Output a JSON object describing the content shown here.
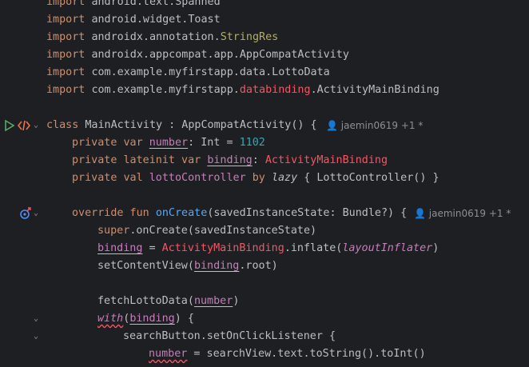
{
  "editor": {
    "lines": [
      {
        "kw": "import",
        "rest": "android.text.Spanned"
      },
      {
        "kw": "import",
        "rest": "android.widget.Toast"
      },
      {
        "kw": "import",
        "pre": "androidx.annotation.",
        "ann": "StringRes"
      },
      {
        "kw": "import",
        "rest": "androidx.appcompat.app.AppCompatActivity"
      },
      {
        "kw": "import",
        "rest": "com.example.myfirstapp.data.LottoData"
      },
      {
        "kw": "import",
        "pre": "com.example.myfirstapp.",
        "red": "databinding",
        "post": ".ActivityMainBinding"
      }
    ],
    "class_line": {
      "kw": "class",
      "rest": " MainActivity : AppCompatActivity() {"
    },
    "var1": {
      "kw": "private var ",
      "name": "number",
      "rest": ": Int = ",
      "num": "1102"
    },
    "var2": {
      "kw": "private lateinit var ",
      "name": "binding",
      "rest": ": ",
      "type": "ActivityMainBinding"
    },
    "var3": {
      "kw": "private val ",
      "name": "lottoController",
      "kw2": " by ",
      "lazy": "lazy",
      "rest": " { LottoController() }"
    },
    "override_line": {
      "kw": "override fun ",
      "fn": "onCreate",
      "rest": "(savedInstanceState: Bundle?) {"
    },
    "l_super": {
      "kw": "super",
      "rest": ".onCreate(savedInstanceState)"
    },
    "l_binding": {
      "name": "binding",
      "rest1": " = ",
      "red": "ActivityMainBinding",
      "rest2": ".inflate(",
      "it": "layoutInflater",
      "rest3": ")"
    },
    "l_setcontent": {
      "pre": "setContentView(",
      "name": "binding",
      "post": ".root)"
    },
    "l_fetch": {
      "pre": "fetchLottoData(",
      "name": "number",
      "post": ")"
    },
    "l_with": {
      "fn": "with",
      "pre": "(",
      "name": "binding",
      "post": ") {"
    },
    "l_search": {
      "text": "searchButton.setOnClickListener {"
    },
    "l_number": {
      "name": "number",
      "rest": " = searchView.text.toString().toInt()"
    },
    "inlay_author": "jaemin0619 +1 *",
    "colors": {
      "background": "#1e1f22",
      "keyword": "#cf8e6d",
      "property": "#c77dbb",
      "number": "#2aacb8",
      "function": "#56a8f5",
      "error": "#f75464",
      "run_icon": "#59a869"
    }
  }
}
